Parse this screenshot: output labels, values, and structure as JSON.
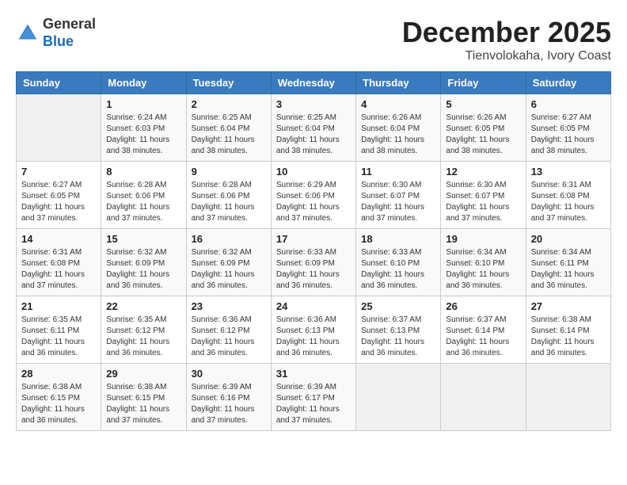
{
  "header": {
    "logo_general": "General",
    "logo_blue": "Blue",
    "month": "December 2025",
    "location": "Tienvolokaha, Ivory Coast"
  },
  "weekdays": [
    "Sunday",
    "Monday",
    "Tuesday",
    "Wednesday",
    "Thursday",
    "Friday",
    "Saturday"
  ],
  "weeks": [
    [
      {
        "day": "",
        "info": ""
      },
      {
        "day": "1",
        "info": "Sunrise: 6:24 AM\nSunset: 6:03 PM\nDaylight: 11 hours\nand 38 minutes."
      },
      {
        "day": "2",
        "info": "Sunrise: 6:25 AM\nSunset: 6:04 PM\nDaylight: 11 hours\nand 38 minutes."
      },
      {
        "day": "3",
        "info": "Sunrise: 6:25 AM\nSunset: 6:04 PM\nDaylight: 11 hours\nand 38 minutes."
      },
      {
        "day": "4",
        "info": "Sunrise: 6:26 AM\nSunset: 6:04 PM\nDaylight: 11 hours\nand 38 minutes."
      },
      {
        "day": "5",
        "info": "Sunrise: 6:26 AM\nSunset: 6:05 PM\nDaylight: 11 hours\nand 38 minutes."
      },
      {
        "day": "6",
        "info": "Sunrise: 6:27 AM\nSunset: 6:05 PM\nDaylight: 11 hours\nand 38 minutes."
      }
    ],
    [
      {
        "day": "7",
        "info": "Sunrise: 6:27 AM\nSunset: 6:05 PM\nDaylight: 11 hours\nand 37 minutes."
      },
      {
        "day": "8",
        "info": "Sunrise: 6:28 AM\nSunset: 6:06 PM\nDaylight: 11 hours\nand 37 minutes."
      },
      {
        "day": "9",
        "info": "Sunrise: 6:28 AM\nSunset: 6:06 PM\nDaylight: 11 hours\nand 37 minutes."
      },
      {
        "day": "10",
        "info": "Sunrise: 6:29 AM\nSunset: 6:06 PM\nDaylight: 11 hours\nand 37 minutes."
      },
      {
        "day": "11",
        "info": "Sunrise: 6:30 AM\nSunset: 6:07 PM\nDaylight: 11 hours\nand 37 minutes."
      },
      {
        "day": "12",
        "info": "Sunrise: 6:30 AM\nSunset: 6:07 PM\nDaylight: 11 hours\nand 37 minutes."
      },
      {
        "day": "13",
        "info": "Sunrise: 6:31 AM\nSunset: 6:08 PM\nDaylight: 11 hours\nand 37 minutes."
      }
    ],
    [
      {
        "day": "14",
        "info": "Sunrise: 6:31 AM\nSunset: 6:08 PM\nDaylight: 11 hours\nand 37 minutes."
      },
      {
        "day": "15",
        "info": "Sunrise: 6:32 AM\nSunset: 6:09 PM\nDaylight: 11 hours\nand 36 minutes."
      },
      {
        "day": "16",
        "info": "Sunrise: 6:32 AM\nSunset: 6:09 PM\nDaylight: 11 hours\nand 36 minutes."
      },
      {
        "day": "17",
        "info": "Sunrise: 6:33 AM\nSunset: 6:09 PM\nDaylight: 11 hours\nand 36 minutes."
      },
      {
        "day": "18",
        "info": "Sunrise: 6:33 AM\nSunset: 6:10 PM\nDaylight: 11 hours\nand 36 minutes."
      },
      {
        "day": "19",
        "info": "Sunrise: 6:34 AM\nSunset: 6:10 PM\nDaylight: 11 hours\nand 36 minutes."
      },
      {
        "day": "20",
        "info": "Sunrise: 6:34 AM\nSunset: 6:11 PM\nDaylight: 11 hours\nand 36 minutes."
      }
    ],
    [
      {
        "day": "21",
        "info": "Sunrise: 6:35 AM\nSunset: 6:11 PM\nDaylight: 11 hours\nand 36 minutes."
      },
      {
        "day": "22",
        "info": "Sunrise: 6:35 AM\nSunset: 6:12 PM\nDaylight: 11 hours\nand 36 minutes."
      },
      {
        "day": "23",
        "info": "Sunrise: 6:36 AM\nSunset: 6:12 PM\nDaylight: 11 hours\nand 36 minutes."
      },
      {
        "day": "24",
        "info": "Sunrise: 6:36 AM\nSunset: 6:13 PM\nDaylight: 11 hours\nand 36 minutes."
      },
      {
        "day": "25",
        "info": "Sunrise: 6:37 AM\nSunset: 6:13 PM\nDaylight: 11 hours\nand 36 minutes."
      },
      {
        "day": "26",
        "info": "Sunrise: 6:37 AM\nSunset: 6:14 PM\nDaylight: 11 hours\nand 36 minutes."
      },
      {
        "day": "27",
        "info": "Sunrise: 6:38 AM\nSunset: 6:14 PM\nDaylight: 11 hours\nand 36 minutes."
      }
    ],
    [
      {
        "day": "28",
        "info": "Sunrise: 6:38 AM\nSunset: 6:15 PM\nDaylight: 11 hours\nand 36 minutes."
      },
      {
        "day": "29",
        "info": "Sunrise: 6:38 AM\nSunset: 6:15 PM\nDaylight: 11 hours\nand 37 minutes."
      },
      {
        "day": "30",
        "info": "Sunrise: 6:39 AM\nSunset: 6:16 PM\nDaylight: 11 hours\nand 37 minutes."
      },
      {
        "day": "31",
        "info": "Sunrise: 6:39 AM\nSunset: 6:17 PM\nDaylight: 11 hours\nand 37 minutes."
      },
      {
        "day": "",
        "info": ""
      },
      {
        "day": "",
        "info": ""
      },
      {
        "day": "",
        "info": ""
      }
    ]
  ]
}
